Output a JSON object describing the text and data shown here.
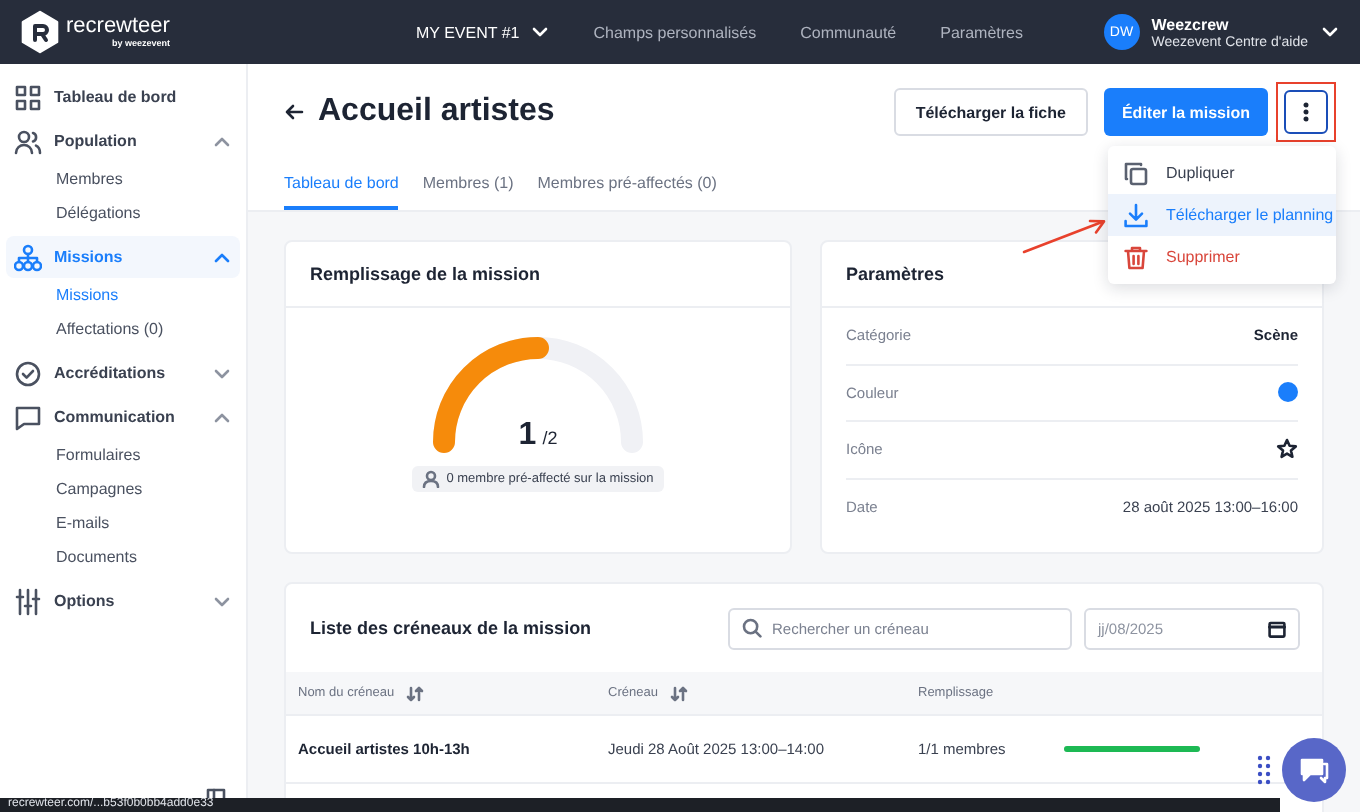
{
  "topbar": {
    "brand": "recrewteer",
    "brand_sub": "by weezevent",
    "event": "MY EVENT #1",
    "nav": [
      {
        "label": "Champs personnalisés"
      },
      {
        "label": "Communauté"
      },
      {
        "label": "Paramètres"
      }
    ],
    "user": {
      "initials": "DW",
      "name": "Weezcrew",
      "subtitle": "Weezevent Centre d'aide"
    }
  },
  "sidebar": {
    "items": [
      {
        "label": "Tableau de bord",
        "selected": false
      },
      {
        "label": "Population",
        "selected": false,
        "expanded": true,
        "children": [
          {
            "label": "Membres",
            "selected": false
          },
          {
            "label": "Délégations",
            "selected": false
          }
        ]
      },
      {
        "label": "Missions",
        "selected": true,
        "expanded": true,
        "children": [
          {
            "label": "Missions",
            "selected": true
          },
          {
            "label": "Affectations (0)",
            "selected": false
          }
        ]
      },
      {
        "label": "Accréditations",
        "selected": false,
        "expanded": false
      },
      {
        "label": "Communication",
        "selected": false,
        "expanded": true,
        "children": [
          {
            "label": "Formulaires",
            "selected": false
          },
          {
            "label": "Campagnes",
            "selected": false
          },
          {
            "label": "E-mails",
            "selected": false
          },
          {
            "label": "Documents",
            "selected": false
          }
        ]
      },
      {
        "label": "Options",
        "selected": false,
        "expanded": false
      }
    ]
  },
  "page": {
    "title": "Accueil artistes",
    "buttons": [
      {
        "label": "Télécharger la fiche",
        "kind": "secondary"
      },
      {
        "label": "Éditer la mission",
        "kind": "primary"
      }
    ],
    "menu": [
      {
        "label": "Dupliquer",
        "kind": "normal",
        "selected": false
      },
      {
        "label": "Télécharger le planning",
        "kind": "normal",
        "selected": true
      },
      {
        "label": "Supprimer",
        "kind": "danger",
        "selected": false
      }
    ],
    "tabs": [
      {
        "label": "Tableau de bord",
        "selected": true
      },
      {
        "label": "Membres (1)",
        "selected": false
      },
      {
        "label": "Membres pré-affectés (0)",
        "selected": false
      }
    ]
  },
  "filling": {
    "title": "Remplissage de la mission",
    "level": 0.5,
    "value": "1",
    "total": "/2",
    "note": "0 membre pré-affecté sur la mission"
  },
  "settings": {
    "title": "Paramètres",
    "rows": [
      {
        "label": "Catégorie",
        "kind": "text",
        "value": "Scène"
      },
      {
        "label": "Couleur",
        "kind": "color",
        "color": "#1a7efb"
      },
      {
        "label": "Icône",
        "kind": "star"
      },
      {
        "label": "Date",
        "kind": "text",
        "value": "28 août 2025 13:00–16:00"
      }
    ]
  },
  "slots": {
    "title": "Liste des créneaux de la mission",
    "search_placeholder": "Rechercher un créneau",
    "date_value": "jj/08/2025",
    "columns": [
      {
        "label": "Nom du créneau",
        "sortable": true
      },
      {
        "label": "Créneau",
        "sortable": true
      },
      {
        "label": "Remplissage",
        "sortable": false
      }
    ],
    "rows": [
      {
        "name": "Accueil artistes 10h-13h",
        "slot": "Jeudi 28 Août 2025 13:00–14:00",
        "filling": "1/1 membres",
        "level": 1
      }
    ]
  },
  "status_bar": {
    "url": "recrewteer.com/...b53f0b0bb4add0e33"
  }
}
